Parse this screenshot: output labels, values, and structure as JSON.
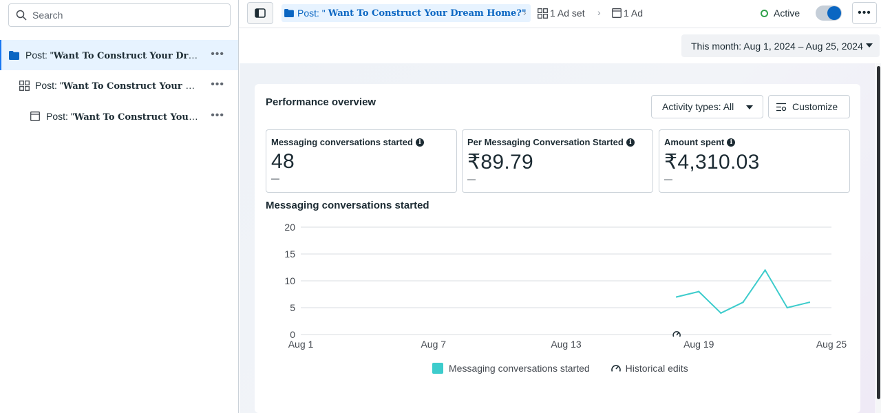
{
  "sidebar": {
    "search_placeholder": "Search",
    "items": [
      {
        "prefix": "Post: \"",
        "title": "Want To Construct Your Dream ...",
        "level": "campaign"
      },
      {
        "prefix": "Post: \"",
        "title": "Want To Construct Your Drea...",
        "level": "ad-set"
      },
      {
        "prefix": "Post: \"",
        "title": "Want To Construct Your Dr...",
        "level": "ad"
      }
    ]
  },
  "topbar": {
    "breadcrumb_main_prefix": "Post: \"",
    "breadcrumb_main_title": "Want To Construct Your Dream Home?\"",
    "breadcrumb_adset": "1 Ad set",
    "breadcrumb_ad": "1 Ad",
    "status": "Active",
    "status_color": "#31a24c",
    "more": "•••"
  },
  "date_range": "This month: Aug 1, 2024 – Aug 25, 2024",
  "overview": {
    "title": "Performance overview",
    "activity_label": "Activity types: All",
    "customize_label": "Customize",
    "metrics": [
      {
        "label": "Messaging conversations started",
        "value": "48",
        "delta": "—"
      },
      {
        "label": "Per Messaging Conversation Started",
        "value": "₹89.79",
        "delta": "—"
      },
      {
        "label": "Amount spent",
        "value": "₹4,310.03",
        "delta": "—"
      }
    ]
  },
  "chart_data": {
    "type": "line",
    "title": "Messaging conversations started",
    "x_ticks": [
      "Aug 1",
      "Aug 7",
      "Aug 13",
      "Aug 19",
      "Aug 25"
    ],
    "y_ticks": [
      0,
      5,
      10,
      15,
      20
    ],
    "ylim": [
      0,
      20
    ],
    "xlim": [
      1,
      25
    ],
    "grid": true,
    "series": [
      {
        "name": "Messaging conversations started",
        "color": "#3dcccc",
        "x": [
          18,
          19,
          20,
          21,
          22,
          23,
          24
        ],
        "y": [
          7,
          8,
          4,
          6,
          12,
          5,
          6
        ]
      }
    ],
    "historical_edit_markers": [
      18
    ],
    "legend": [
      "Messaging conversations started",
      "Historical edits"
    ],
    "legend_position": "bottom"
  }
}
